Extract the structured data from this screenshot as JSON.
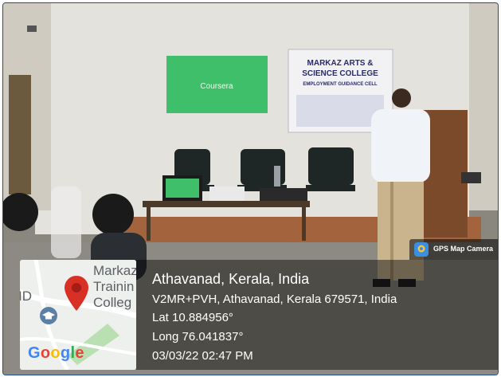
{
  "photo": {
    "banner": {
      "line1": "MARKAZ ARTS &",
      "line2": "SCIENCE COLLEGE",
      "line3": "EMPLOYMENT GUIDANCE CELL"
    },
    "projected_slide": "Coursera"
  },
  "map": {
    "place_label_line1": "Markaz",
    "place_label_line2": "Trainin",
    "place_label_line3": "Colleg",
    "edge_label": "ID",
    "logo": "Google"
  },
  "location": {
    "title": "Athavanad, Kerala, India",
    "address": "V2MR+PVH, Athavanad, Kerala 679571, India",
    "latitude": "Lat 10.884956°",
    "longitude": "Long 76.041837°",
    "datetime": "03/03/22 02:47 PM"
  },
  "badge": {
    "label": "GPS Map Camera",
    "icon": "gps-map-camera-icon"
  }
}
